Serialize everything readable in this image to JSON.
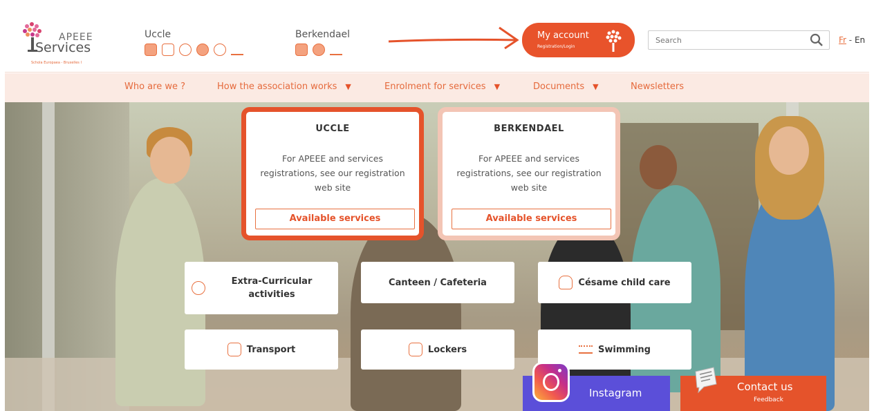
{
  "logo": {
    "line1": "APEEE",
    "line2": "Services",
    "tagline": "Schola Europaea - Bruxelles I"
  },
  "header": {
    "sites": [
      {
        "name": "Uccle",
        "icons": [
          "bus-icon",
          "lock-icon",
          "apple-icon",
          "ball-icon",
          "hand-icon",
          "swimming-icon"
        ]
      },
      {
        "name": "Berkendael",
        "icons": [
          "bus-icon",
          "ball-icon",
          "swimming-icon"
        ]
      }
    ],
    "account": {
      "label": "My account",
      "sublabel": "Registration/Login"
    },
    "search": {
      "placeholder": "Search"
    },
    "lang": {
      "fr": "Fr",
      "separator": " - ",
      "en": "En"
    }
  },
  "nav": {
    "items": [
      {
        "label": "Who are we ?",
        "caret": ""
      },
      {
        "label": "How the association works",
        "caret": "▼"
      },
      {
        "label": "Enrolment for services",
        "caret": "▼"
      },
      {
        "label": "Documents",
        "caret": "▼"
      },
      {
        "label": "Newsletters",
        "caret": ""
      }
    ]
  },
  "cards": [
    {
      "title": "UCCLE",
      "text": "For APEEE and services registrations, see our registration web site",
      "button": "Available services"
    },
    {
      "title": "BERKENDAEL",
      "text": "For APEEE and services registrations, see our registration web site",
      "button": "Available services"
    }
  ],
  "services": [
    {
      "label": "Extra-Curricular activities",
      "icon": "ball-icon"
    },
    {
      "label": "Canteen / Cafeteria",
      "icon": ""
    },
    {
      "label": "Césame child care",
      "icon": "hand-icon"
    },
    {
      "label": "Transport",
      "icon": "bus-icon"
    },
    {
      "label": "Lockers",
      "icon": "lock-icon"
    },
    {
      "label": "Swimming",
      "icon": "swimming-icon"
    }
  ],
  "instagram": {
    "label": "Instagram"
  },
  "contact": {
    "label": "Contact us",
    "sublabel": "Feedback"
  },
  "colors": {
    "accent": "#e5532b",
    "accent_light": "#f3c5b5",
    "nav_bg": "#fbeae3",
    "instagram_bg": "#5b4fd9"
  }
}
